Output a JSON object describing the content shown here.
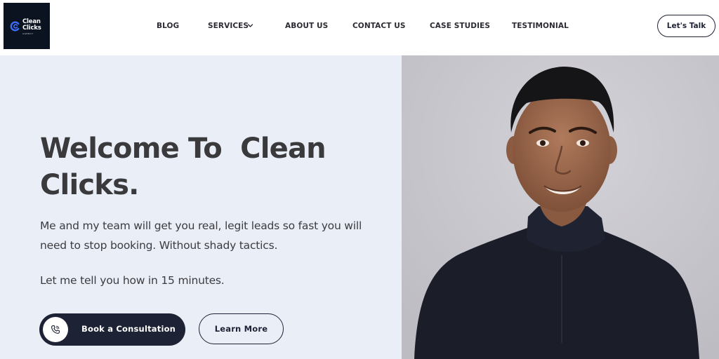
{
  "header": {
    "logo": {
      "line1": "Clean",
      "line2": "Clicks",
      "sub": "AGENCY"
    },
    "nav": [
      {
        "label": "BLOG"
      },
      {
        "label": "SERVICES"
      },
      {
        "label": "ABOUT US"
      },
      {
        "label": "CONTACT US"
      },
      {
        "label": "CASE STUDIES"
      },
      {
        "label": "TESTIMONIAL"
      }
    ],
    "cta_label": "Let's Talk"
  },
  "hero": {
    "title": "Welcome To  Clean\nClicks.",
    "description": "Me and my team will get you real, legit leads so fast you will need to stop booking. Without shady tactics.",
    "tagline": "Let me tell you how in 15 minutes.",
    "book_label": "Book a Consultation",
    "learn_label": "Learn More"
  },
  "icons": {
    "nav_chevron": "chevron-down-icon",
    "book": "phone-icon"
  },
  "colors": {
    "dark": "#1e2235",
    "hero_bg": "#e9eef7",
    "photo_bg": "#c4c3c9",
    "logo_bg": "#0c1320",
    "logo_accent": "#3b6cf6"
  }
}
